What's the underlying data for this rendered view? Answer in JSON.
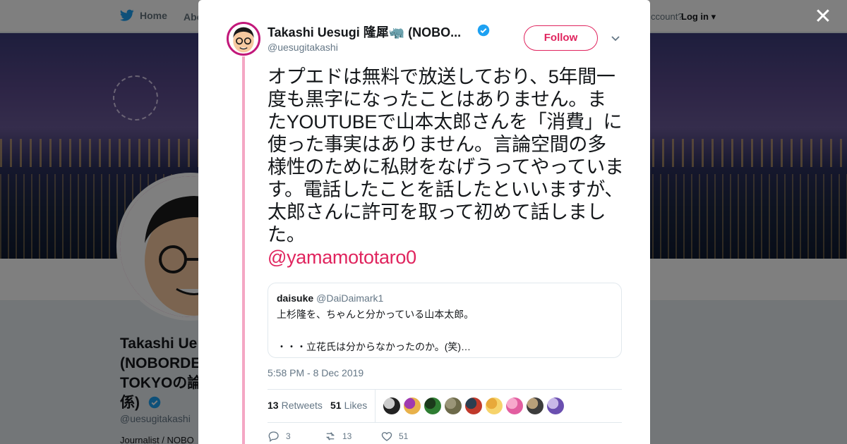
{
  "nav": {
    "home_label": "Home",
    "about_label": "Abo",
    "account_text": "ccount?",
    "login_label": "Log in"
  },
  "profile": {
    "name_display": "Takashi Ue (NOBORDE TOKYOの論 係)",
    "name_lines": [
      "Takashi Ue",
      "(NOBORDE",
      "TOKYOの論",
      "係)"
    ],
    "handle": "@uesugitakashi",
    "bio": "Journalist / NOBO"
  },
  "tweet": {
    "author_name": "Takashi Uesugi 隆犀🦏 (NOBO...",
    "author_handle": "@uesugitakashi",
    "follow_label": "Follow",
    "text": "オプエドは無料で放送しており、5年間一度も黒字になったことはありません。またYOUTUBEで山本太郎さんを「消費」に使った事実はありません。言論空間の多様性のために私財をなげうってやっています。電話したことを話したといいますが、太郎さんに許可を取って初めて話しました。",
    "mention": "@yamamototaro0",
    "timestamp": "5:58 PM - 8 Dec 2019",
    "quote": {
      "name": "daisuke",
      "handle": "@DaiDaimark1",
      "line1": "上杉隆を、ちゃんと分かっている山本太郎。",
      "line2": "",
      "line3": "・・・立花氏は分からなかったのか。(笑)…"
    },
    "stats": {
      "retweets_count": "13",
      "retweets_label": "Retweets",
      "likes_count": "51",
      "likes_label": "Likes"
    },
    "likers": [
      {
        "color": "#222222",
        "accent": "#cccccc"
      },
      {
        "color": "#e8b14a",
        "accent": "#a03ab0"
      },
      {
        "color": "#2e7d32",
        "accent": "#1b3a1b"
      },
      {
        "color": "#6d6a4a",
        "accent": "#9a9578"
      },
      {
        "color": "#c0392b",
        "accent": "#2c3e50"
      },
      {
        "color": "#f6d36b",
        "accent": "#e8a93a"
      },
      {
        "color": "#e25ea0",
        "accent": "#f7a8cc"
      },
      {
        "color": "#3c3c3c",
        "accent": "#b8a07a"
      },
      {
        "color": "#6a4fb0",
        "accent": "#c8b8e8"
      }
    ],
    "actions": {
      "reply_count": "3",
      "retweet_count": "13",
      "like_count": "51"
    }
  },
  "colors": {
    "accent": "#e0245e",
    "thread": "#f4a7c4",
    "verified": "#1da1f2",
    "avatar_ring": "#c2187a"
  }
}
